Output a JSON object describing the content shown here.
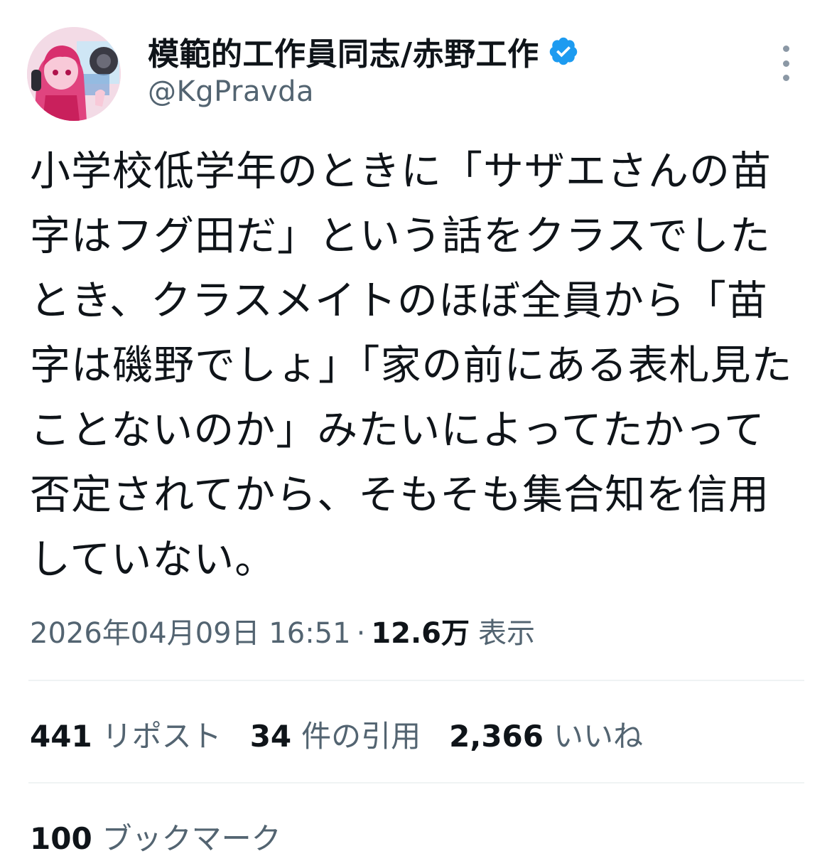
{
  "author": {
    "display_name": "模範的工作員同志/赤野工作",
    "handle": "@KgPravda",
    "verified": true,
    "verified_color": "#1d9bf0"
  },
  "tweet": {
    "lines": [
      "小学校低学年のときに「サザエさんの苗",
      "字はフグ田だ」という話をクラスでした",
      "とき、クラスメイトのほぼ全員から「苗",
      "字は磯野でしょ」「家の前にある表札見た",
      "ことないのか」みたいによってたかって",
      "否定されてから、そもそも集合知を信用",
      "していない。"
    ]
  },
  "meta": {
    "timestamp": "2026年04月09日 16:51",
    "separator": "·",
    "views_count": "12.6万",
    "views_label": "表示"
  },
  "stats": {
    "reposts": {
      "count": "441",
      "label": "リポスト"
    },
    "quotes": {
      "count": "34",
      "label": "件の引用"
    },
    "likes": {
      "count": "2,366",
      "label": "いいね"
    },
    "bookmarks": {
      "count": "100",
      "label": "ブックマーク"
    }
  },
  "icons": {
    "avatar": "avatar-illustration",
    "verified": "verified-badge-icon",
    "more": "more-options-icon"
  },
  "colors": {
    "text_primary": "#0f1419",
    "text_secondary": "#536471",
    "divider": "#eff3f4",
    "avatar_accent": "#e0447f"
  }
}
